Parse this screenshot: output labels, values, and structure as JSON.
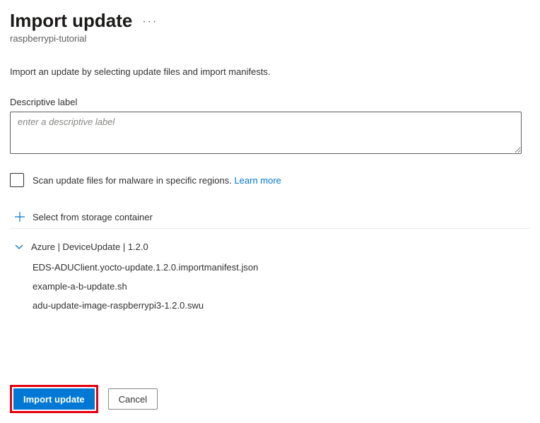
{
  "header": {
    "title": "Import update",
    "subtitle": "raspberrypi-tutorial"
  },
  "description": "Import an update by selecting update files and import manifests.",
  "label_field": {
    "label": "Descriptive label",
    "placeholder": "enter a descriptive label"
  },
  "scan": {
    "text": "Scan update files for malware in specific regions.",
    "link": "Learn more"
  },
  "storage": {
    "label": "Select from storage container"
  },
  "group": {
    "title": "Azure | DeviceUpdate | 1.2.0",
    "files": [
      "EDS-ADUClient.yocto-update.1.2.0.importmanifest.json",
      "example-a-b-update.sh",
      "adu-update-image-raspberrypi3-1.2.0.swu"
    ]
  },
  "footer": {
    "primary": "Import update",
    "secondary": "Cancel"
  }
}
